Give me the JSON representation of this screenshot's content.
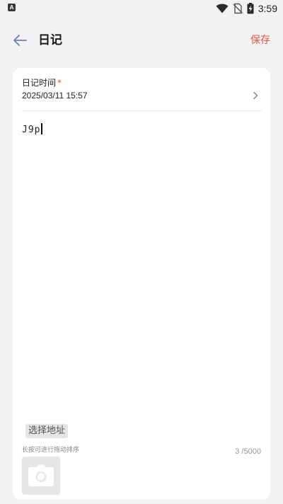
{
  "status_bar": {
    "app_icon_letter": "A",
    "time": "3:59",
    "icons": [
      "wifi-icon",
      "no-sim-icon",
      "battery-charging-icon"
    ]
  },
  "header": {
    "title": "日记",
    "save_label": "保存",
    "back_icon": "arrow-left-icon"
  },
  "form": {
    "time_label": "日记时间",
    "required_mark": "*",
    "time_value": "2025/03/11 15:57",
    "content_text": "J9p",
    "address_button": "选择地址",
    "sort_hint": "长按可进行拖动排序",
    "char_count": "3 /5000",
    "photo_icon": "camera-icon"
  },
  "colors": {
    "accent": "#e9553a",
    "back_arrow": "#6f7fa8",
    "background": "#f2f2f4",
    "card": "#ffffff"
  }
}
